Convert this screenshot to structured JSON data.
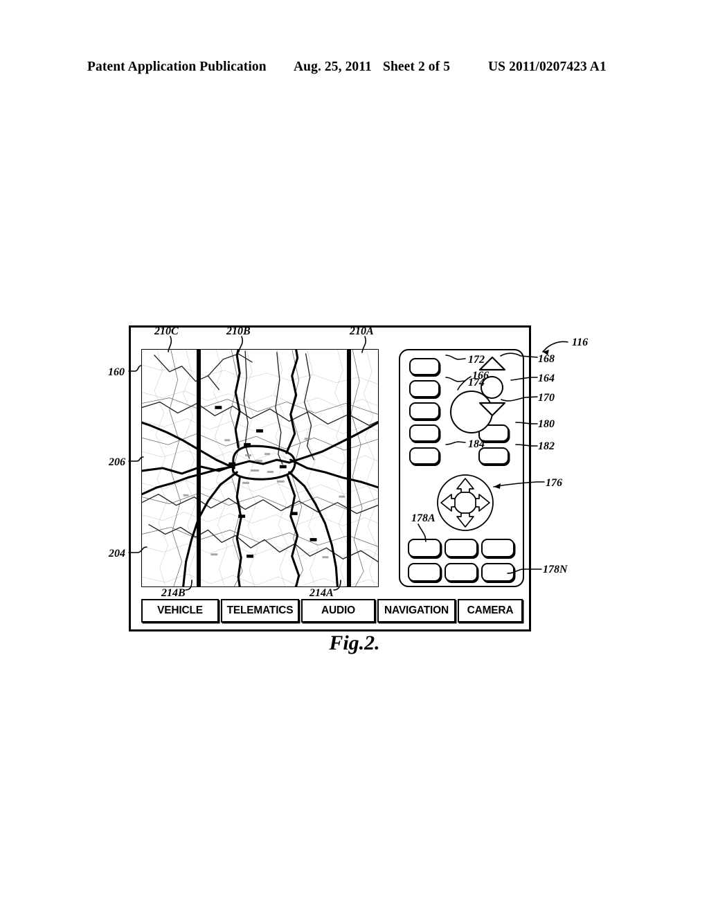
{
  "page": {
    "header": {
      "publication": "Patent Application Publication",
      "date": "Aug. 25, 2011",
      "sheet": "Sheet 2 of 5",
      "patent_number": "US 2011/0207423 A1"
    },
    "figure_caption": "Fig.2."
  },
  "device": {
    "reference": "116",
    "bezel_reference": "160",
    "display_reference": "204",
    "map_feature_reference": "206"
  },
  "map": {
    "segment_labels": [
      "210A",
      "210B",
      "210C"
    ],
    "seam_labels": [
      "214A",
      "214B"
    ]
  },
  "controls": {
    "left_column": [
      {
        "ref": "172",
        "name": "softkey-172"
      },
      {
        "ref": "174",
        "name": "softkey-174"
      },
      {
        "ref": "",
        "name": "softkey-unlabeled-1"
      },
      {
        "ref": "",
        "name": "softkey-unlabeled-2"
      },
      {
        "ref": "184",
        "name": "softkey-184"
      }
    ],
    "right_column": [
      {
        "ref": "180",
        "name": "softkey-180"
      },
      {
        "ref": "182",
        "name": "softkey-182"
      }
    ],
    "knob": {
      "ref": "166",
      "name": "rotary-knob"
    },
    "up_triangle": {
      "ref": "168",
      "name": "up-arrow-button"
    },
    "center_circle": {
      "ref": "164",
      "name": "select-button"
    },
    "down_triangle": {
      "ref": "170",
      "name": "down-arrow-button"
    },
    "rocker": {
      "ref": "176",
      "name": "four-way-rocker"
    },
    "grid_first": {
      "ref": "178A",
      "name": "preset-key-first"
    },
    "grid_last": {
      "ref": "178N",
      "name": "preset-key-last"
    }
  },
  "menu": {
    "tabs": [
      {
        "label": "VEHICLE"
      },
      {
        "label": "TELEMATICS"
      },
      {
        "label": "AUDIO"
      },
      {
        "label": "NAVIGATION"
      },
      {
        "label": "CAMERA"
      }
    ]
  },
  "colors": {
    "ink": "#000000",
    "paper": "#ffffff",
    "map_road_major": "#1a1a1a",
    "map_road_minor": "#9a9a9a"
  }
}
